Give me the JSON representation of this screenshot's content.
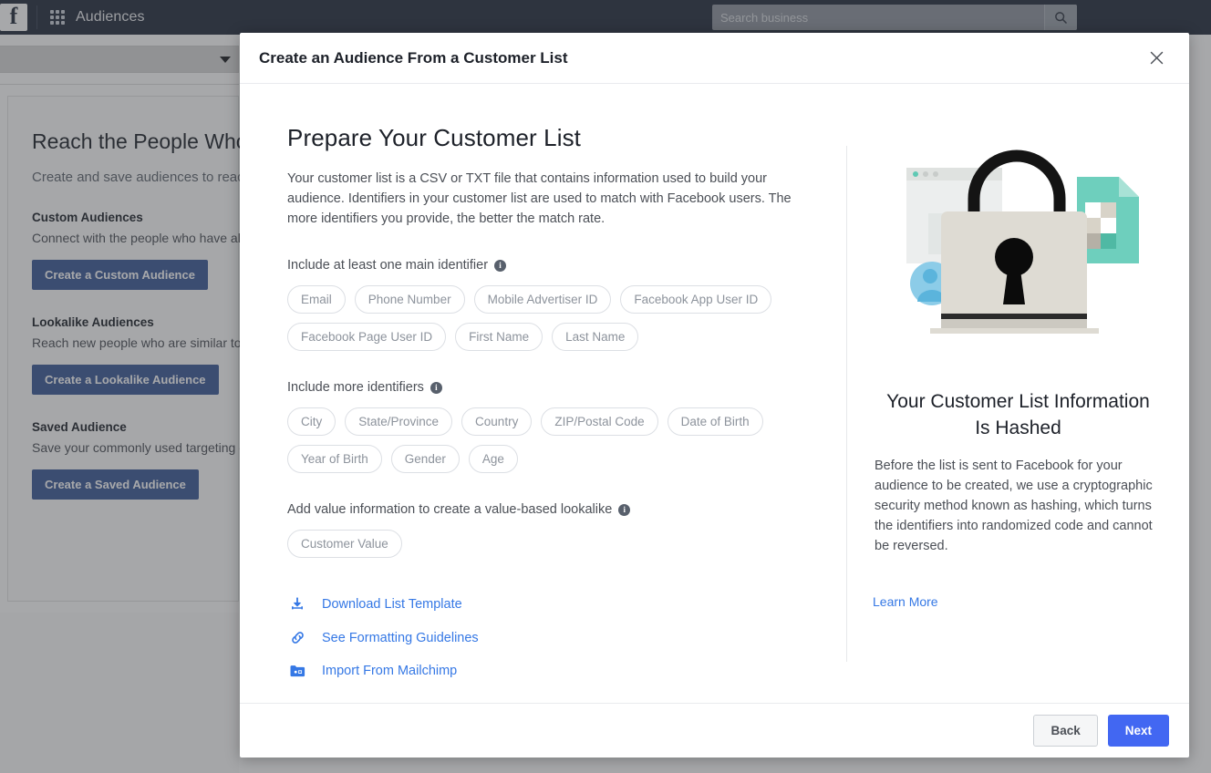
{
  "topbar": {
    "logo": "f",
    "grid_icon": "apps-grid-icon",
    "title": "Audiences",
    "search_placeholder": "Search business",
    "search_value": "",
    "search_icon": "search-icon"
  },
  "background": {
    "heading": "Reach the People Who Matter to You",
    "subheading": "Create and save audiences to reach the people who matter",
    "sections": [
      {
        "title": "Custom Audiences",
        "body": "Connect with the people who have already shown interest with Custom Audiences. You can create an audience from your customer list.",
        "button": "Create a Custom Audience"
      },
      {
        "title": "Lookalike Audiences",
        "body": "Reach new people who are similar to your existing customers. Create an audience based on people who like your Page and use Lookalike Audiences.",
        "button": "Create a Lookalike Audience"
      },
      {
        "title": "Saved Audience",
        "body": "Save your commonly used targeting options. Choose demographics, interests and behaviors, then save them to reuse in future ads.",
        "button": "Create a Saved Audience"
      }
    ]
  },
  "modal": {
    "title": "Create an Audience From a Customer List",
    "close_icon": "close-icon",
    "left": {
      "heading": "Prepare Your Customer List",
      "lead": "Your customer list is a CSV or TXT file that contains information used to build your audience. Identifiers in your customer list are used to match with Facebook users. The more identifiers you provide, the better the match rate.",
      "groups": [
        {
          "label": "Include at least one main identifier",
          "info_icon": "info-icon",
          "chips": [
            "Email",
            "Phone Number",
            "Mobile Advertiser ID",
            "Facebook App User ID",
            "Facebook Page User ID",
            "First Name",
            "Last Name"
          ]
        },
        {
          "label": "Include more identifiers",
          "info_icon": "info-icon",
          "chips": [
            "City",
            "State/Province",
            "Country",
            "ZIP/Postal Code",
            "Date of Birth",
            "Year of Birth",
            "Gender",
            "Age"
          ]
        },
        {
          "label": "Add value information to create a value-based lookalike",
          "info_icon": "info-icon",
          "chips": [
            "Customer Value"
          ]
        }
      ],
      "links": [
        {
          "label": "Download List Template",
          "icon": "download-icon"
        },
        {
          "label": "See Formatting Guidelines",
          "icon": "link-chain-icon"
        },
        {
          "label": "Import From Mailchimp",
          "icon": "folder-import-icon"
        }
      ]
    },
    "right": {
      "illustration": "padlock-illustration",
      "title": "Your Customer List Information Is Hashed",
      "body": "Before the list is sent to Facebook for your audience to be created, we use a cryptographic security method known as hashing, which turns the identifiers into randomized code and cannot be reversed.",
      "link": "Learn More"
    },
    "footer": {
      "back": "Back",
      "next": "Next"
    }
  },
  "colors": {
    "primary_blue": "#4267f2",
    "link_blue": "#3578e5",
    "topbar_dark": "#232c3c",
    "bg_button_blue": "#3b5998"
  }
}
